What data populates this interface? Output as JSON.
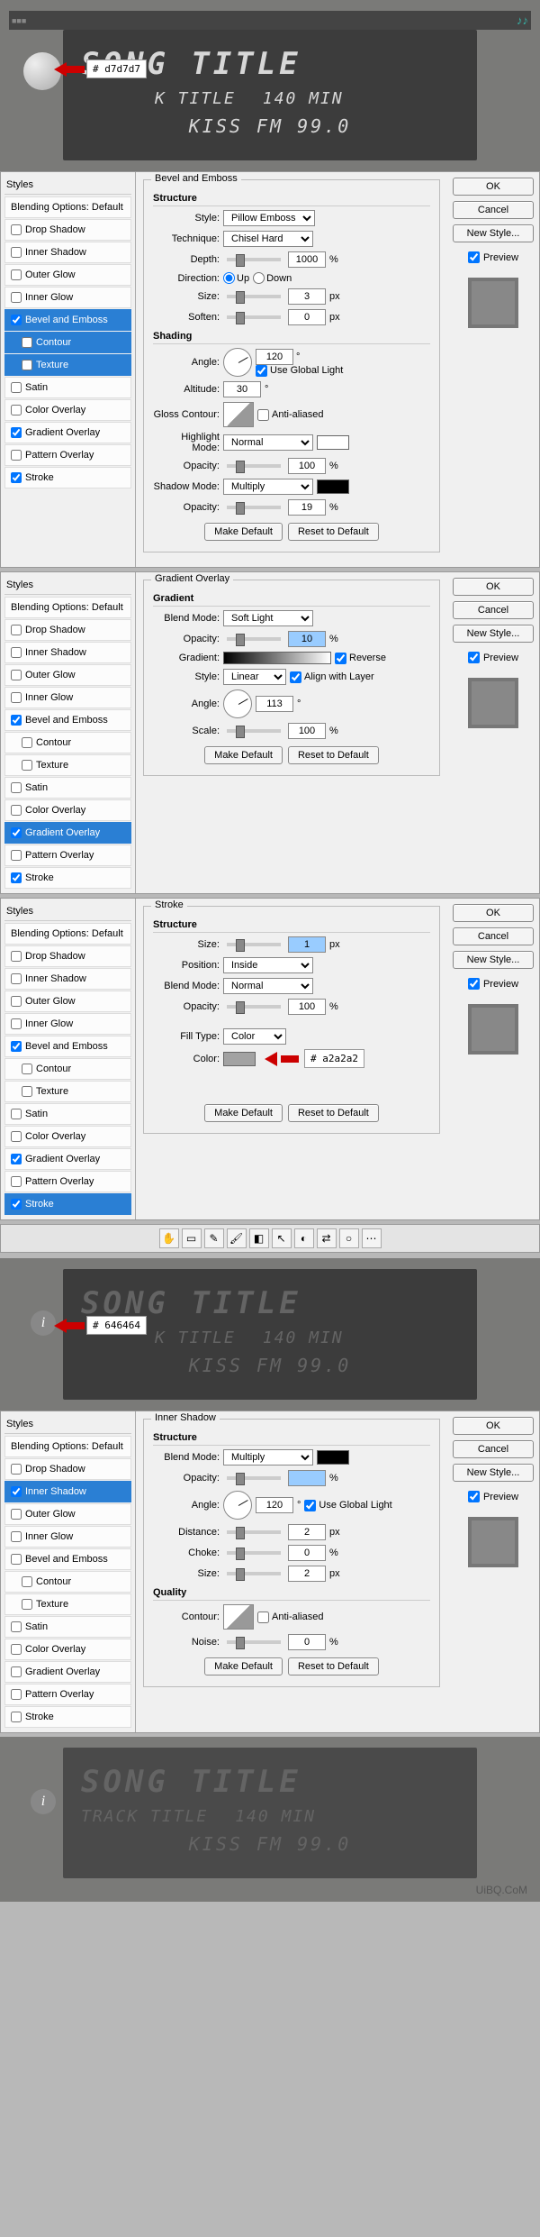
{
  "preview1": {
    "song": "SONG TITLE",
    "track_partial": "K TITLE",
    "time": "140 MIN",
    "station": "KISS FM 99.0",
    "swatch": "# d7d7d7"
  },
  "dialog1": {
    "styles_header": "Styles",
    "blending_opts": "Blending Options: Default",
    "items": {
      "drop_shadow": "Drop Shadow",
      "inner_shadow": "Inner Shadow",
      "outer_glow": "Outer Glow",
      "inner_glow": "Inner Glow",
      "bevel_emboss": "Bevel and Emboss",
      "contour": "Contour",
      "texture": "Texture",
      "satin": "Satin",
      "color_overlay": "Color Overlay",
      "gradient_overlay": "Gradient Overlay",
      "pattern_overlay": "Pattern Overlay",
      "stroke": "Stroke"
    },
    "bevel": {
      "title": "Bevel and Emboss",
      "structure": "Structure",
      "style_lbl": "Style:",
      "style_val": "Pillow Emboss",
      "technique_lbl": "Technique:",
      "technique_val": "Chisel Hard",
      "depth_lbl": "Depth:",
      "depth_val": "1000",
      "depth_unit": "%",
      "direction_lbl": "Direction:",
      "dir_up": "Up",
      "dir_down": "Down",
      "size_lbl": "Size:",
      "size_val": "3",
      "size_unit": "px",
      "soften_lbl": "Soften:",
      "soften_val": "0",
      "soften_unit": "px",
      "shading": "Shading",
      "angle_lbl": "Angle:",
      "angle_val": "120",
      "global_light": "Use Global Light",
      "altitude_lbl": "Altitude:",
      "altitude_val": "30",
      "gloss_contour_lbl": "Gloss Contour:",
      "anti_aliased": "Anti-aliased",
      "highlight_mode_lbl": "Highlight Mode:",
      "highlight_mode_val": "Normal",
      "opacity_lbl": "Opacity:",
      "hl_opacity_val": "100",
      "shadow_mode_lbl": "Shadow Mode:",
      "shadow_mode_val": "Multiply",
      "sh_opacity_val": "19",
      "pct": "%"
    },
    "actions": {
      "ok": "OK",
      "cancel": "Cancel",
      "new_style": "New Style...",
      "preview": "Preview",
      "make_default": "Make Default",
      "reset_default": "Reset to Default"
    }
  },
  "dialog2": {
    "grad": {
      "title": "Gradient Overlay",
      "gradient": "Gradient",
      "blend_mode_lbl": "Blend Mode:",
      "blend_mode_val": "Soft Light",
      "opacity_lbl": "Opacity:",
      "opacity_val": "10",
      "pct": "%",
      "gradient_lbl": "Gradient:",
      "reverse": "Reverse",
      "style_lbl": "Style:",
      "style_val": "Linear",
      "align": "Align with Layer",
      "angle_lbl": "Angle:",
      "angle_val": "113",
      "scale_lbl": "Scale:",
      "scale_val": "100"
    }
  },
  "dialog3": {
    "stroke": {
      "title": "Stroke",
      "structure": "Structure",
      "size_lbl": "Size:",
      "size_val": "1",
      "size_unit": "px",
      "position_lbl": "Position:",
      "position_val": "Inside",
      "blend_mode_lbl": "Blend Mode:",
      "blend_mode_val": "Normal",
      "opacity_lbl": "Opacity:",
      "opacity_val": "100",
      "pct": "%",
      "fill_type_lbl": "Fill Type:",
      "fill_type_val": "Color",
      "color_lbl": "Color:",
      "color_hex": "# a2a2a2"
    }
  },
  "preview2": {
    "song": "SONG TITLE",
    "track_partial": "K TITLE",
    "time": "140 MIN",
    "station": "KISS FM 99.0",
    "swatch": "# 646464"
  },
  "dialog4": {
    "inner_shadow": {
      "title": "Inner Shadow",
      "structure": "Structure",
      "blend_mode_lbl": "Blend Mode:",
      "blend_mode_val": "Multiply",
      "opacity_lbl": "Opacity:",
      "opacity_val": "",
      "pct": "%",
      "angle_lbl": "Angle:",
      "angle_val": "120",
      "global_light": "Use Global Light",
      "distance_lbl": "Distance:",
      "distance_val": "2",
      "px": "px",
      "choke_lbl": "Choke:",
      "choke_val": "0",
      "size_lbl": "Size:",
      "size_val": "2",
      "quality": "Quality",
      "contour_lbl": "Contour:",
      "anti_aliased": "Anti-aliased",
      "noise_lbl": "Noise:",
      "noise_val": "0"
    }
  },
  "preview3": {
    "song": "SONG TITLE",
    "track": "TRACK TITLE",
    "time": "140 MIN",
    "station": "KISS FM 99.0",
    "watermark": "UiBQ.CoM"
  },
  "info_glyph": "i"
}
